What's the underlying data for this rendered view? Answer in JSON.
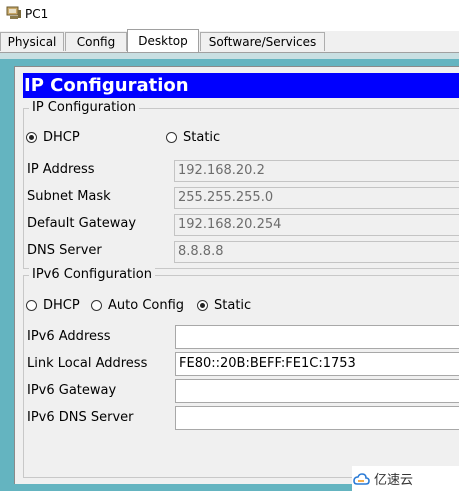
{
  "window": {
    "title": "PC1"
  },
  "tabs": [
    {
      "label": "Physical"
    },
    {
      "label": "Config"
    },
    {
      "label": "Desktop"
    },
    {
      "label": "Software/Services"
    }
  ],
  "active_tab": "Desktop",
  "panel": {
    "title": "IP Configuration",
    "ipv4": {
      "legend": "IP Configuration",
      "dhcp_label": "DHCP",
      "static_label": "Static",
      "selected": "DHCP",
      "ip_address": {
        "label": "IP Address",
        "value": "192.168.20.2"
      },
      "subnet_mask": {
        "label": "Subnet Mask",
        "value": "255.255.255.0"
      },
      "default_gateway": {
        "label": "Default Gateway",
        "value": "192.168.20.254"
      },
      "dns_server": {
        "label": "DNS Server",
        "value": "8.8.8.8"
      }
    },
    "ipv6": {
      "legend": "IPv6 Configuration",
      "dhcp_label": "DHCP",
      "auto_label": "Auto Config",
      "static_label": "Static",
      "selected": "Static",
      "ipv6_address": {
        "label": "IPv6 Address",
        "value": ""
      },
      "link_local": {
        "label": "Link Local Address",
        "value": "FE80::20B:BEFF:FE1C:1753"
      },
      "ipv6_gateway": {
        "label": "IPv6 Gateway",
        "value": ""
      },
      "ipv6_dns": {
        "label": "IPv6 DNS Server",
        "value": ""
      }
    }
  },
  "watermark": {
    "text": "亿速云"
  }
}
